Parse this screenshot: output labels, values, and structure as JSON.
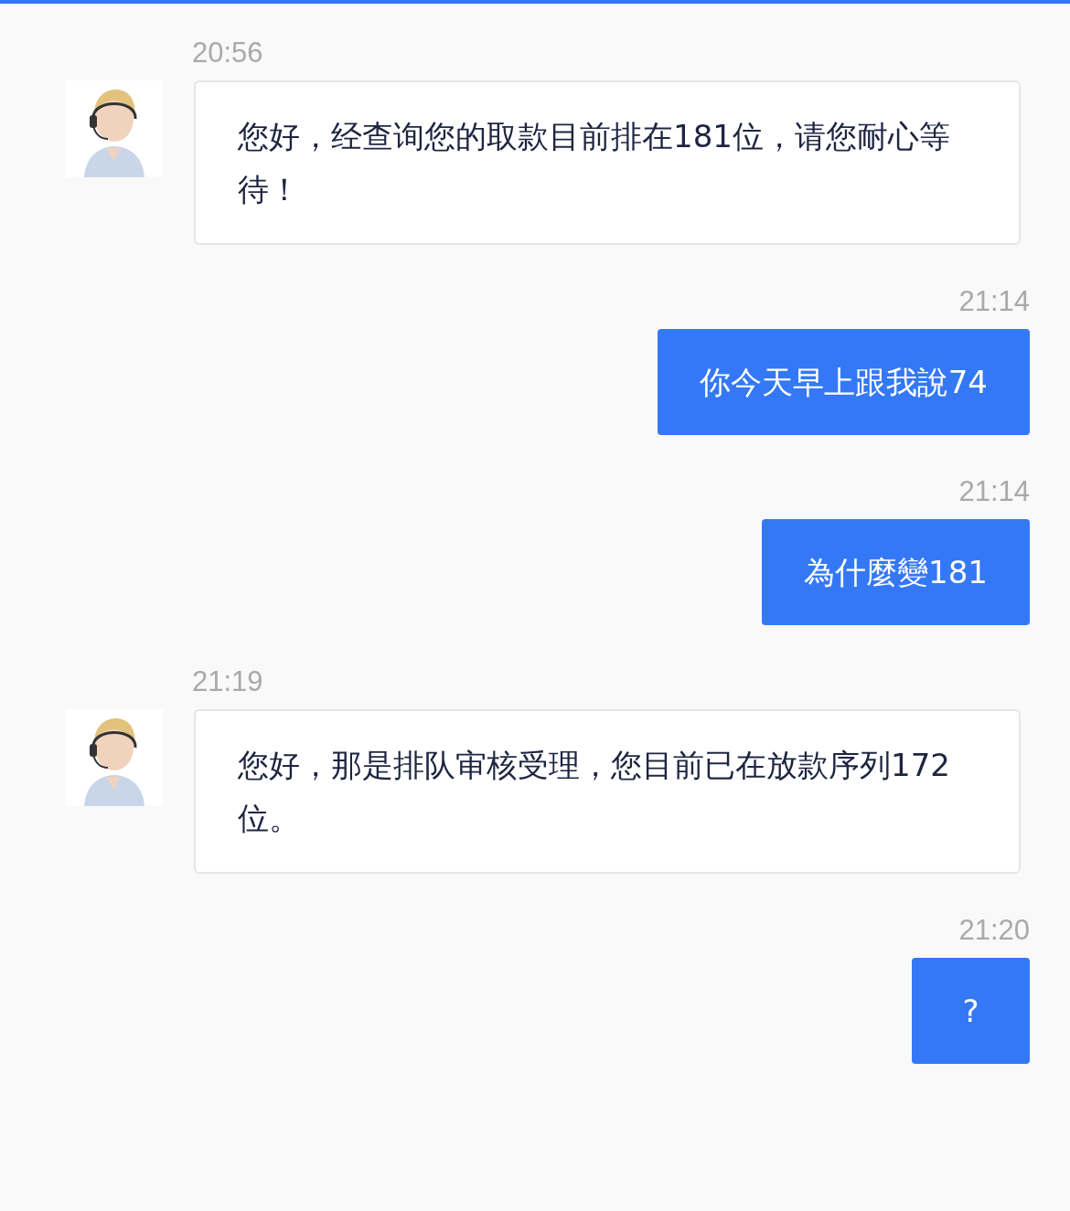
{
  "messages": [
    {
      "kind": "agent",
      "time": "20:56",
      "text": "您好，经查询您的取款目前排在181位，请您耐心等待！"
    },
    {
      "kind": "user",
      "time": "21:14",
      "text": "你今天早上跟我說74"
    },
    {
      "kind": "user",
      "time": "21:14",
      "text": "為什麼變181"
    },
    {
      "kind": "agent",
      "time": "21:19",
      "text": "您好，那是排队审核受理，您目前已在放款序列172位。"
    },
    {
      "kind": "user",
      "time": "21:20",
      "text": "?"
    }
  ]
}
